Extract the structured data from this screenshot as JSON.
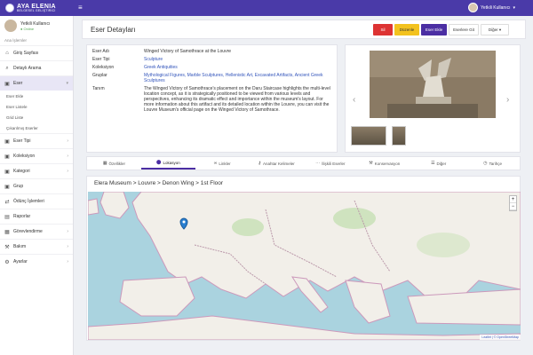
{
  "app": {
    "brand_title": "AYA ELENIA",
    "brand_subtitle": "BELGESEL GELİŞTİRİCİ",
    "menu_icon": "hamburger-icon"
  },
  "topbar": {
    "user_name": "Yetkili Kullanıcı"
  },
  "sidebar": {
    "user_name": "Yetkili Kullanıcı",
    "user_status": "Online",
    "section_label": "Ana İşlemler",
    "items": [
      {
        "label": "Giriş Sayfası",
        "icon": "home-icon"
      },
      {
        "label": "Detaylı Arama",
        "icon": "search-icon"
      },
      {
        "label": "Eser",
        "icon": "folder-icon"
      },
      {
        "label": "Eser Tipi",
        "icon": "folder-icon"
      },
      {
        "label": "Koleksiyon",
        "icon": "folder-icon"
      },
      {
        "label": "Kategori",
        "icon": "folder-icon"
      },
      {
        "label": "Grup",
        "icon": "folder-icon"
      },
      {
        "label": "Ödünç İşlemleri",
        "icon": "swap-icon"
      },
      {
        "label": "Raporlar",
        "icon": "chart-icon"
      },
      {
        "label": "Görevlendirme",
        "icon": "clipboard-icon"
      },
      {
        "label": "Bakım",
        "icon": "wrench-icon"
      },
      {
        "label": "Ayarlar",
        "icon": "gear-icon"
      }
    ],
    "subitems": [
      "Eser Ekle",
      "Eser Listele",
      "Grid Liste",
      "Çıkarılmış Eserler"
    ]
  },
  "header": {
    "title": "Eser Detayları",
    "delete_label": "Sil",
    "edit_label": "Düzenle",
    "add_label": "Eser Ekle",
    "go_label": "Eserlere Git",
    "other_label": "Diğer"
  },
  "details": {
    "rows": [
      {
        "label": "Eser Adı",
        "value": "Winged Victory of Samothrace at the Louvre",
        "link": false
      },
      {
        "label": "Eser Tipi",
        "value": "Sculpture",
        "link": true
      },
      {
        "label": "Koleksiyon",
        "value": "Greek Antiquities",
        "link": true
      },
      {
        "label": "Gruplar",
        "value": "Mythological Figures, Marble Sculptures, Hellenistic Art, Excavated Artifacts, Ancient Greek Sculptures",
        "link": true
      },
      {
        "label": "Tanım",
        "value": "The Winged Victory of Samothrace's placement on the Daru Staircase highlights the multi-level location concept, as it is strategically positioned to be viewed from various levels and perspectives, enhancing its dramatic effect and importance within the museum's layout. For more information about this artifact and its detailed location within the Louvre, you can visit the Louvre Museum's official page on the Winged Victory of Samothrace.",
        "link": false
      }
    ]
  },
  "tabs": [
    {
      "label": "Özellikler",
      "icon": "grid-icon"
    },
    {
      "label": "Lokasyon",
      "icon": "map-pin-icon"
    },
    {
      "label": "Linkler",
      "icon": "link-icon"
    },
    {
      "label": "Anahtar Kelimeler",
      "icon": "key-icon"
    },
    {
      "label": "İlişkili Eserler",
      "icon": "relation-icon"
    },
    {
      "label": "Konservasyon",
      "icon": "wrench-icon"
    },
    {
      "label": "Diğer",
      "icon": "list-icon"
    },
    {
      "label": "Tarihçe",
      "icon": "clock-icon"
    }
  ],
  "map": {
    "breadcrumb": "Elera Museum > Louvre > Denon Wing > 1st Floor",
    "zoom_in": "+",
    "zoom_out": "−",
    "attribution": "Leaflet | © OpenStreetMap"
  }
}
